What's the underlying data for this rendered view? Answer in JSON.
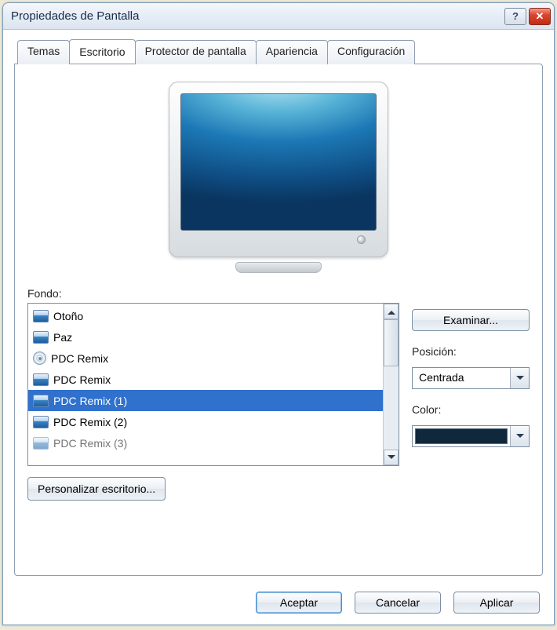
{
  "window": {
    "title": "Propiedades de Pantalla"
  },
  "tabs": {
    "items": [
      {
        "label": "Temas"
      },
      {
        "label": "Escritorio"
      },
      {
        "label": "Protector de pantalla"
      },
      {
        "label": "Apariencia"
      },
      {
        "label": "Configuración"
      }
    ],
    "active_index": 1
  },
  "background": {
    "label": "Fondo:",
    "items": [
      {
        "name": "Otoño",
        "icon": "img"
      },
      {
        "name": "Paz",
        "icon": "img"
      },
      {
        "name": "PDC Remix",
        "icon": "cd"
      },
      {
        "name": "PDC Remix",
        "icon": "img"
      },
      {
        "name": "PDC Remix (1)",
        "icon": "img"
      },
      {
        "name": "PDC Remix (2)",
        "icon": "img"
      },
      {
        "name": "PDC Remix (3)",
        "icon": "img"
      }
    ],
    "selected_index": 4,
    "browse_label": "Examinar...",
    "personalize_label": "Personalizar escritorio..."
  },
  "position": {
    "label": "Posición:",
    "value": "Centrada"
  },
  "color": {
    "label": "Color:",
    "value_hex": "#10283c"
  },
  "buttons": {
    "ok": "Aceptar",
    "cancel": "Cancelar",
    "apply": "Aplicar"
  }
}
